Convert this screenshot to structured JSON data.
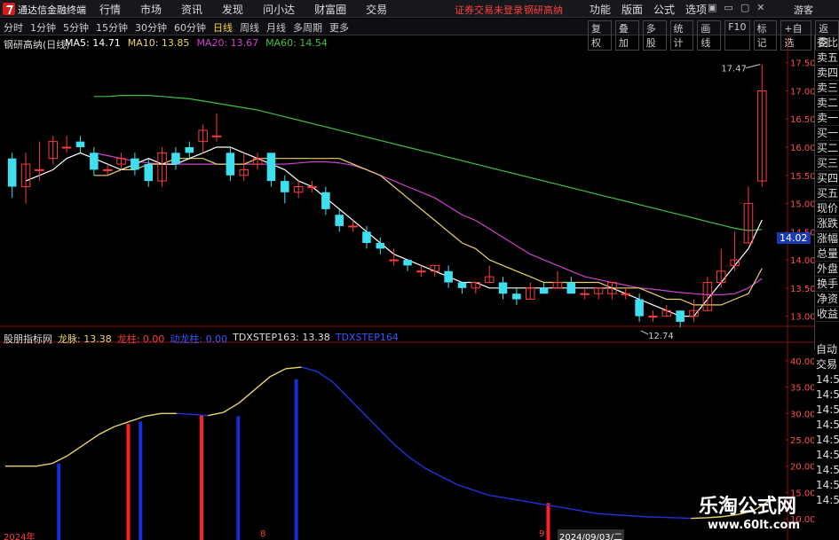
{
  "topbar": {
    "app_title": "通达信金融终端",
    "menu": [
      "行情",
      "市场",
      "资讯",
      "发现",
      "问小达",
      "财富圈",
      "交易"
    ],
    "login_warning": "证券交易未登录",
    "stock_name": "钢研高纳",
    "right_menu": [
      "功能",
      "版面",
      "公式",
      "选项"
    ],
    "window_controls": [
      "▣",
      "▭",
      "▢",
      "✕"
    ],
    "guest": "游客"
  },
  "toolbar": {
    "periods": [
      "分时",
      "1分钟",
      "5分钟",
      "15分钟",
      "30分钟",
      "60分钟",
      "日线",
      "周线",
      "月线",
      "多周期",
      "更多"
    ],
    "active_period": "日线",
    "buttons": [
      "复权",
      "叠加",
      "多股",
      "统计",
      "画线",
      "F10",
      "标记",
      "+自选",
      "返回"
    ]
  },
  "chart_header": {
    "stock": "钢研高纳(日线)",
    "ma5": "MA5: 14.71",
    "ma10": "MA10: 13.85",
    "ma20": "MA20: 13.67",
    "ma60": "MA60: 14.54"
  },
  "indicator_header": {
    "name": "股朋指标网",
    "longmai": "龙脉: 13.38",
    "longzhu": "龙柱: 0.00",
    "dongzhu": "动龙柱: 0.00",
    "tdx163": "TDXSTEP163: 13.38",
    "tdx164": "TDXSTEP164"
  },
  "price_axis": [
    "17.50",
    "17.00",
    "16.50",
    "16.00",
    "15.50",
    "15.00",
    "14.50",
    "14.00",
    "13.50",
    "13.00"
  ],
  "indicator_axis": [
    "40.00",
    "35.00",
    "30.00",
    "25.00",
    "20.00",
    "15.00",
    "10.00"
  ],
  "side_labels": [
    "委比",
    "卖五",
    "卖四",
    "卖三",
    "卖二",
    "卖一",
    "买一",
    "买二",
    "买三",
    "买四",
    "买五",
    "现价",
    "涨跌",
    "涨幅",
    "总量",
    "外盘",
    "换手",
    "净资",
    "收益"
  ],
  "side_labels_lower": [
    "自动",
    "交易",
    "14:56",
    "14:56",
    "14:56",
    "14:56",
    "14:56",
    "14:56",
    "14:56",
    "14:56",
    "14:56"
  ],
  "current_price_tag": "14.02",
  "high_label": "17.47",
  "low_label": "12.74",
  "date_labels": [
    "2024年",
    "8",
    "9",
    "2024/09/03/二"
  ],
  "watermark": {
    "line1": "乐淘公式网",
    "line2": "www.60lt.com"
  },
  "colors": {
    "up": "#ff3b3b",
    "down": "#3ee0f0",
    "ma5": "#ffffff",
    "ma10": "#e8d46a",
    "ma20": "#d040d0",
    "ma60": "#40c040",
    "dragon_line": "#e8d46a",
    "blue": "#1a2bd8"
  },
  "chart_data": {
    "type": "candlestick",
    "ylim": [
      12.6,
      17.7
    ],
    "candles": [
      [
        15.8,
        15.3,
        15.9,
        15.1
      ],
      [
        15.3,
        15.7,
        15.9,
        15.0
      ],
      [
        15.6,
        15.6,
        16.1,
        15.4
      ],
      [
        15.8,
        16.1,
        16.2,
        15.7
      ],
      [
        16.0,
        16.0,
        16.2,
        15.9
      ],
      [
        16.1,
        16.0,
        16.2,
        15.9
      ],
      [
        15.9,
        15.6,
        16.0,
        15.5
      ],
      [
        15.6,
        15.6,
        15.7,
        15.5
      ],
      [
        15.7,
        15.8,
        15.9,
        15.6
      ],
      [
        15.8,
        15.6,
        15.9,
        15.5
      ],
      [
        15.7,
        15.4,
        15.8,
        15.3
      ],
      [
        15.4,
        15.9,
        16.0,
        15.3
      ],
      [
        15.9,
        15.7,
        16.0,
        15.6
      ],
      [
        16.0,
        15.9,
        16.1,
        15.8
      ],
      [
        16.1,
        16.3,
        16.4,
        15.9
      ],
      [
        16.2,
        16.2,
        16.6,
        16.1
      ],
      [
        15.9,
        15.5,
        16.0,
        15.4
      ],
      [
        15.5,
        15.6,
        15.9,
        15.4
      ],
      [
        15.7,
        15.8,
        15.9,
        15.6
      ],
      [
        15.9,
        15.4,
        15.9,
        15.3
      ],
      [
        15.4,
        15.2,
        15.5,
        15.0
      ],
      [
        15.2,
        15.3,
        15.4,
        15.1
      ],
      [
        15.3,
        15.3,
        15.4,
        15.2
      ],
      [
        15.2,
        14.9,
        15.3,
        14.8
      ],
      [
        14.8,
        14.6,
        14.9,
        14.5
      ],
      [
        14.6,
        14.6,
        14.7,
        14.5
      ],
      [
        14.5,
        14.3,
        14.6,
        14.2
      ],
      [
        14.3,
        14.2,
        14.4,
        14.1
      ],
      [
        14.0,
        14.0,
        14.2,
        13.9
      ],
      [
        14.0,
        13.9,
        14.0,
        13.8
      ],
      [
        13.8,
        13.8,
        13.9,
        13.7
      ],
      [
        13.8,
        13.9,
        13.9,
        13.7
      ],
      [
        13.8,
        13.6,
        13.9,
        13.5
      ],
      [
        13.6,
        13.5,
        13.6,
        13.4
      ],
      [
        13.5,
        13.6,
        13.6,
        13.4
      ],
      [
        13.6,
        13.7,
        13.9,
        13.6
      ],
      [
        13.6,
        13.4,
        13.7,
        13.3
      ],
      [
        13.4,
        13.3,
        13.5,
        13.2
      ],
      [
        13.3,
        13.5,
        13.6,
        13.3
      ],
      [
        13.5,
        13.4,
        13.6,
        13.4
      ],
      [
        13.5,
        13.6,
        13.8,
        13.5
      ],
      [
        13.6,
        13.4,
        13.7,
        13.4
      ],
      [
        13.4,
        13.4,
        13.5,
        13.3
      ],
      [
        13.4,
        13.5,
        13.5,
        13.3
      ],
      [
        13.4,
        13.6,
        13.6,
        13.3
      ],
      [
        13.4,
        13.4,
        13.5,
        13.3
      ],
      [
        13.3,
        13.0,
        13.4,
        12.9
      ],
      [
        13.0,
        13.0,
        13.1,
        12.9
      ],
      [
        13.0,
        13.1,
        13.2,
        13.0
      ],
      [
        13.1,
        12.9,
        13.1,
        12.8
      ],
      [
        13.0,
        13.1,
        13.3,
        12.9
      ],
      [
        13.1,
        13.6,
        13.7,
        13.1
      ],
      [
        13.6,
        13.8,
        14.2,
        13.5
      ],
      [
        13.9,
        14.0,
        14.5,
        13.8
      ],
      [
        14.3,
        15.0,
        15.3,
        14.3
      ],
      [
        15.4,
        17.0,
        17.47,
        15.3
      ]
    ],
    "ma5": [
      15.4,
      15.5,
      15.6,
      15.8,
      15.9,
      15.8,
      15.7,
      15.6,
      15.7,
      15.8,
      15.7,
      15.7,
      15.8,
      15.9,
      16.0,
      16.0,
      15.9,
      15.8,
      15.7,
      15.6,
      15.4,
      15.3,
      15.1,
      14.9,
      14.7,
      14.5,
      14.3,
      14.1,
      14.0,
      13.9,
      13.8,
      13.7,
      13.6,
      13.6,
      13.5,
      13.5,
      13.5,
      13.5,
      13.5,
      13.5,
      13.5,
      13.5,
      13.5,
      13.5,
      13.4,
      13.3,
      13.2,
      13.1,
      13.0,
      13.0,
      13.3,
      13.6,
      13.9,
      14.2,
      14.71
    ],
    "ma10": [
      15.5,
      15.5,
      15.6,
      15.6,
      15.7,
      15.7,
      15.8,
      15.8,
      15.8,
      15.7,
      15.7,
      15.7,
      15.8,
      15.8,
      15.8,
      15.8,
      15.8,
      15.8,
      15.8,
      15.7,
      15.6,
      15.5,
      15.3,
      15.1,
      14.9,
      14.7,
      14.5,
      14.3,
      14.2,
      14.0,
      13.9,
      13.8,
      13.7,
      13.6,
      13.6,
      13.6,
      13.6,
      13.6,
      13.5,
      13.5,
      13.5,
      13.4,
      13.3,
      13.3,
      13.2,
      13.2,
      13.2,
      13.3,
      13.4,
      13.85
    ],
    "ma20": [
      15.9,
      15.85,
      15.8,
      15.75,
      15.72,
      15.7,
      15.7,
      15.7,
      15.7,
      15.7,
      15.7,
      15.7,
      15.7,
      15.7,
      15.7,
      15.72,
      15.74,
      15.74,
      15.72,
      15.68,
      15.6,
      15.5,
      15.4,
      15.3,
      15.2,
      15.1,
      14.95,
      14.8,
      14.7,
      14.55,
      14.4,
      14.25,
      14.1,
      14.0,
      13.9,
      13.8,
      13.7,
      13.65,
      13.6,
      13.55,
      13.5,
      13.48,
      13.45,
      13.42,
      13.4,
      13.38,
      13.38,
      13.4,
      13.5,
      13.67
    ],
    "ma60": [
      16.9,
      16.9,
      16.92,
      16.92,
      16.92,
      16.9,
      16.88,
      16.86,
      16.82,
      16.78,
      16.74,
      16.7,
      16.66,
      16.6,
      16.54,
      16.48,
      16.42,
      16.36,
      16.3,
      16.24,
      16.18,
      16.12,
      16.06,
      16.0,
      15.94,
      15.88,
      15.82,
      15.76,
      15.7,
      15.64,
      15.58,
      15.52,
      15.46,
      15.4,
      15.34,
      15.28,
      15.22,
      15.16,
      15.1,
      15.04,
      14.98,
      14.92,
      14.86,
      14.8,
      14.74,
      14.68,
      14.62,
      14.56,
      14.52,
      14.54
    ]
  },
  "indicator_data": {
    "ylim": [
      8,
      42
    ],
    "dragon_line": [
      20,
      20,
      20,
      20.5,
      22,
      24,
      26,
      27.5,
      28.5,
      29.5,
      30,
      30,
      29.8,
      29.6,
      30.2,
      32,
      34.5,
      37,
      38.5,
      38.8,
      38,
      36,
      33,
      30,
      27,
      24,
      21.5,
      19.5,
      18,
      16.5,
      15.5,
      14.5,
      14,
      13.5,
      13,
      12.5,
      12,
      11.5,
      11,
      10.8,
      10.6,
      10.4,
      10.3,
      10.2,
      10.1,
      10.2,
      10.4,
      10.8,
      11.5,
      13.38
    ],
    "bars": [
      {
        "pos": 0.07,
        "value": 20.5,
        "color": "blue"
      },
      {
        "pos": 0.161,
        "value": 28,
        "color": "red"
      },
      {
        "pos": 0.177,
        "value": 28.5,
        "color": "blue"
      },
      {
        "pos": 0.257,
        "value": 29.8,
        "color": "red"
      },
      {
        "pos": 0.305,
        "value": 29.5,
        "color": "blue"
      },
      {
        "pos": 0.381,
        "value": 36.5,
        "color": "blue"
      },
      {
        "pos": 0.711,
        "value": 13,
        "color": "red"
      }
    ]
  }
}
